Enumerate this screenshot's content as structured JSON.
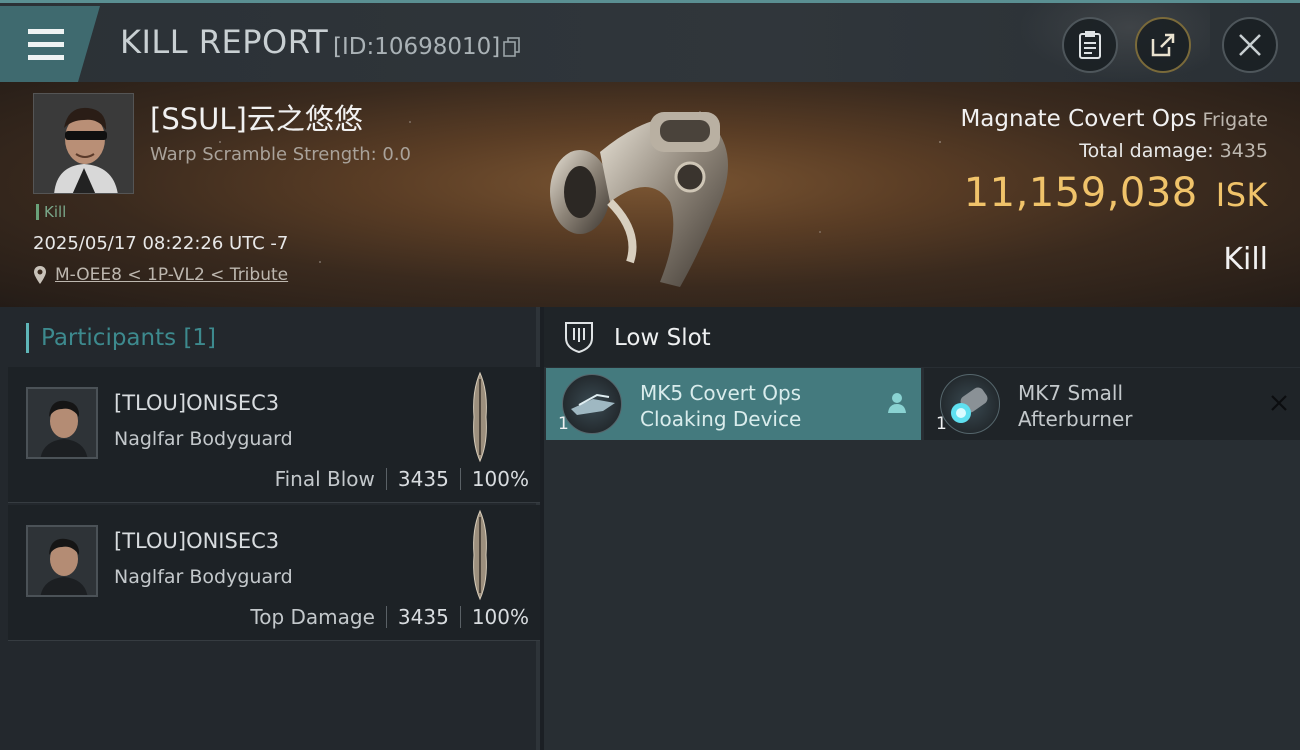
{
  "header": {
    "title": "KILL REPORT",
    "report_id": "[ID:10698010]",
    "icons": [
      "menu-icon",
      "copy-icon",
      "clipboard-icon",
      "share-icon",
      "close-icon"
    ]
  },
  "victim": {
    "pilot_name": "[SSUL]云之悠悠",
    "warp_scramble": "Warp Scramble Strength: 0.0",
    "kill_tag": "Kill",
    "datetime": "2025/05/17 08:22:26 UTC -7",
    "location": "M-OEE8 < 1P-VL2 < Tribute",
    "ship_name": "Magnate Covert Ops",
    "ship_class": "Frigate",
    "total_damage_label": "Total damage:",
    "total_damage": "3435",
    "isk_value": "11,159,038",
    "isk_unit": "ISK",
    "result": "Kill"
  },
  "participants": {
    "header": "Participants [1]",
    "rows": [
      {
        "name": "[TLOU]ONISEC3",
        "ship": "Naglfar Bodyguard",
        "role": "Final Blow",
        "damage": "3435",
        "percent": "100%"
      },
      {
        "name": "[TLOU]ONISEC3",
        "ship": "Naglfar Bodyguard",
        "role": "Top Damage",
        "damage": "3435",
        "percent": "100%"
      }
    ]
  },
  "slots": {
    "title": "Low Slot",
    "modules": [
      {
        "qty": "1",
        "name_line1": "MK5 Covert Ops",
        "name_line2": "Cloaking Device",
        "status_icon": "pilot-icon",
        "highlighted": true
      },
      {
        "qty": "1",
        "name_line1": "MK7 Small",
        "name_line2": "Afterburner",
        "status_icon": "x-icon",
        "highlighted": false
      }
    ]
  },
  "colors": {
    "accent_teal": "#447a7e",
    "isk_gold": "#f0c36a",
    "participants_header": "#3d8a8e"
  }
}
